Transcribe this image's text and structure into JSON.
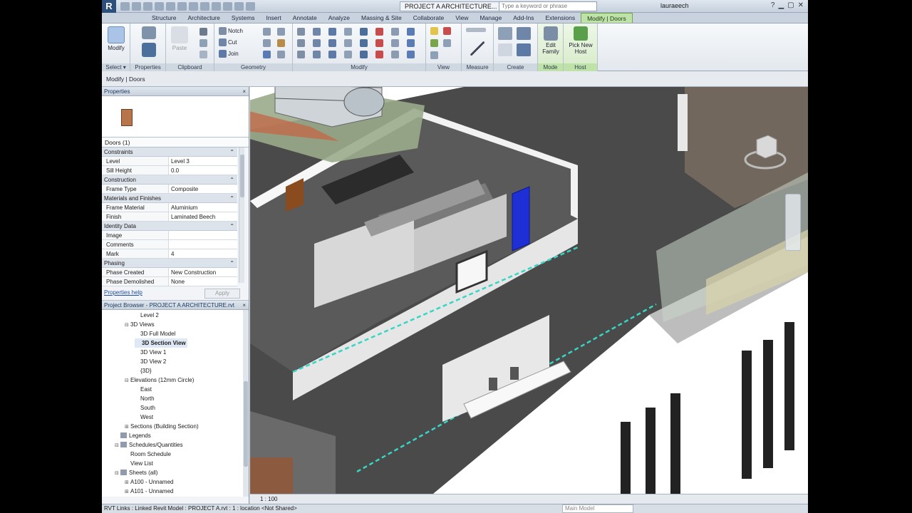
{
  "titlebar": {
    "logo": "R",
    "document_title": "PROJECT A ARCHITECTURE...",
    "search_placeholder": "Type a keyword or phrase",
    "user": "lauraeech",
    "help": "?"
  },
  "tabs": [
    "Structure",
    "Architecture",
    "Systems",
    "Insert",
    "Annotate",
    "Analyze",
    "Massing & Site",
    "Collaborate",
    "View",
    "Manage",
    "Add-Ins",
    "Extensions",
    "Modify | Doors"
  ],
  "ribbon": {
    "panels": {
      "select": "Select ▾",
      "properties": "Properties",
      "clipboard": "Clipboard",
      "geometry": "Geometry",
      "modify": "Modify",
      "view": "View",
      "measure": "Measure",
      "create": "Create",
      "mode": "Mode",
      "host": "Host"
    },
    "modify_btn": "Modify",
    "paste_btn": "Paste",
    "notch": "Notch",
    "cut": "Cut",
    "join": "Join",
    "edit_family": "Edit Family",
    "pick_new_host": "Pick New Host"
  },
  "options_bar": "Modify | Doors",
  "properties": {
    "header": "Properties",
    "type_name": "",
    "selector": "Doors (1)",
    "groups": [
      {
        "name": "Constraints",
        "rows": [
          [
            "Level",
            "Level 3"
          ],
          [
            "Sill Height",
            "0.0"
          ]
        ]
      },
      {
        "name": "Construction",
        "rows": [
          [
            "Frame Type",
            "Composite"
          ]
        ]
      },
      {
        "name": "Materials and Finishes",
        "rows": [
          [
            "Frame Material",
            "Aluminium"
          ],
          [
            "Finish",
            "Laminated Beech"
          ]
        ]
      },
      {
        "name": "Identity Data",
        "rows": [
          [
            "Image",
            ""
          ],
          [
            "Comments",
            ""
          ],
          [
            "Mark",
            "4"
          ]
        ]
      },
      {
        "name": "Phasing",
        "rows": [
          [
            "Phase Created",
            "New Construction"
          ],
          [
            "Phase Demolished",
            "None"
          ]
        ]
      }
    ],
    "help_link": "Properties help",
    "apply": "Apply"
  },
  "browser": {
    "header": "Project Browser - PROJECT A ARCHITECTURE.rvt",
    "close": "×",
    "items": [
      {
        "label": "Level 2",
        "indent": 3,
        "exp": ""
      },
      {
        "label": "3D Views",
        "indent": 2,
        "exp": "⊟"
      },
      {
        "label": "3D Full Model",
        "indent": 3,
        "exp": ""
      },
      {
        "label": "3D Section View",
        "indent": 3,
        "exp": "",
        "selected": true
      },
      {
        "label": "3D View 1",
        "indent": 3,
        "exp": ""
      },
      {
        "label": "3D View 2",
        "indent": 3,
        "exp": ""
      },
      {
        "label": "{3D}",
        "indent": 3,
        "exp": ""
      },
      {
        "label": "Elevations (12mm Circle)",
        "indent": 2,
        "exp": "⊟"
      },
      {
        "label": "East",
        "indent": 3,
        "exp": ""
      },
      {
        "label": "North",
        "indent": 3,
        "exp": ""
      },
      {
        "label": "South",
        "indent": 3,
        "exp": ""
      },
      {
        "label": "West",
        "indent": 3,
        "exp": ""
      },
      {
        "label": "Sections (Building Section)",
        "indent": 2,
        "exp": "⊞"
      },
      {
        "label": "Legends",
        "indent": 1,
        "exp": "",
        "icon": true
      },
      {
        "label": "Schedules/Quantities",
        "indent": 1,
        "exp": "⊟",
        "icon": true
      },
      {
        "label": "Room Schedule",
        "indent": 2,
        "exp": ""
      },
      {
        "label": "View List",
        "indent": 2,
        "exp": ""
      },
      {
        "label": "Sheets (all)",
        "indent": 1,
        "exp": "⊟",
        "icon": true
      },
      {
        "label": "A100 - Unnamed",
        "indent": 2,
        "exp": "⊞"
      },
      {
        "label": "A101 - Unnamed",
        "indent": 2,
        "exp": "⊞"
      }
    ]
  },
  "viewport": {
    "scale": "1 : 100"
  },
  "statusbar": {
    "text": "RVT Links : Linked Revit Model : PROJECT A.rvt : 1 : location <Not Shared>",
    "model": "Main Model"
  },
  "colors": {
    "accent_green": "#bfe2a9",
    "selection_blue": "#1f2fd6",
    "section_line": "#37d6c3",
    "floor": "#4a4a4a"
  }
}
